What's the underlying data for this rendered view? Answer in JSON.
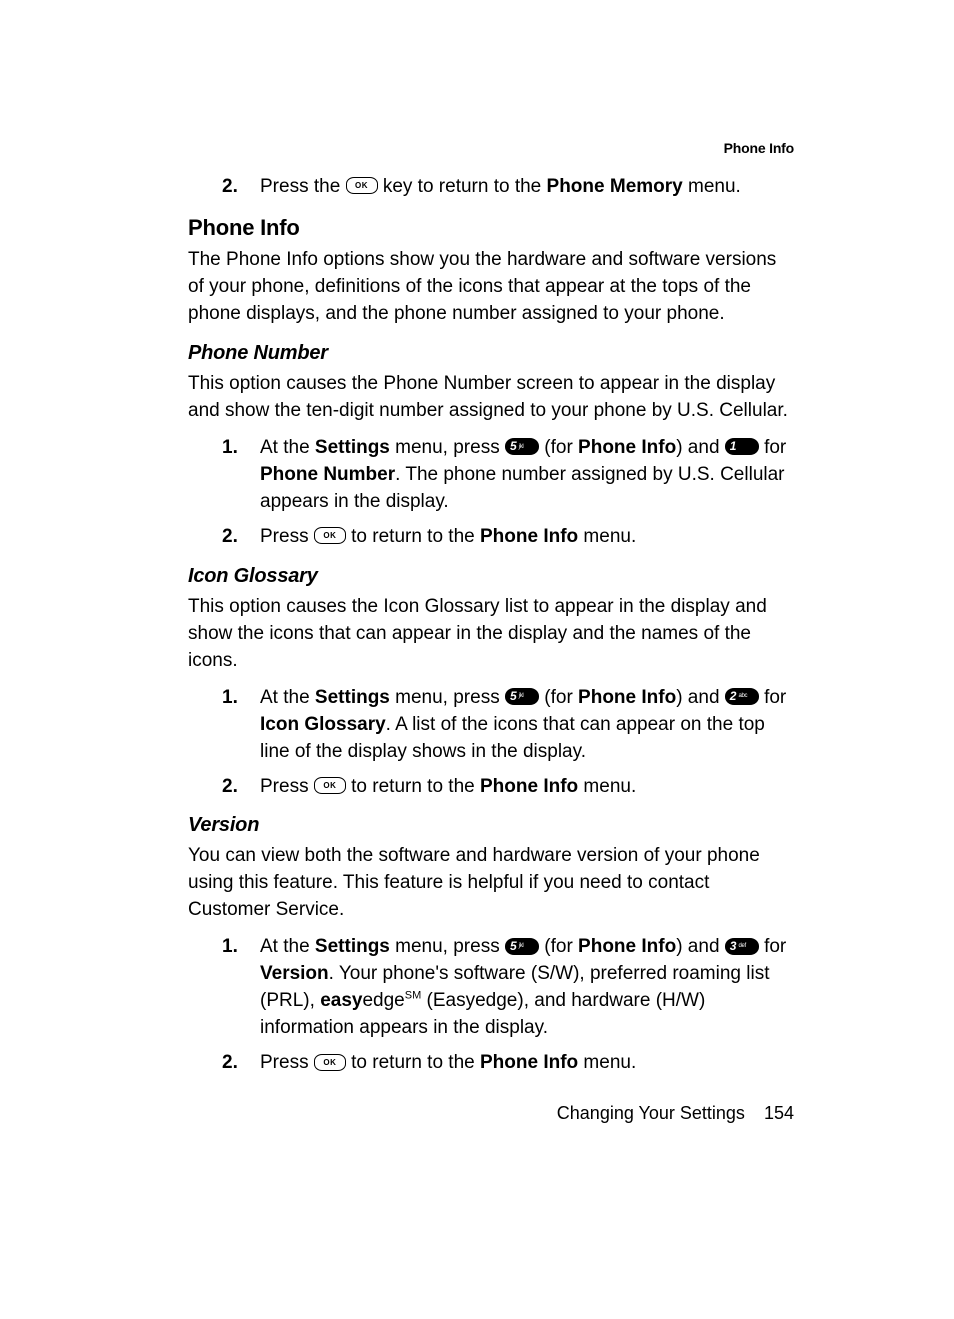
{
  "runningHead": "Phone Info",
  "topList": {
    "item2": {
      "num": "2.",
      "pre": "Press the ",
      "post1": " key to return to the ",
      "bold": "Phone Memory",
      "post2": " menu."
    }
  },
  "section": {
    "title": "Phone Info",
    "intro": "The Phone Info options show you the hardware and software versions of your phone, definitions of the icons that appear at the tops of the phone displays, and the phone number assigned to your phone."
  },
  "phoneNumber": {
    "title": "Phone Number",
    "intro": "This option causes the Phone Number screen to appear in the display and show the ten-digit number assigned to your phone by U.S. Cellular.",
    "step1": {
      "num": "1.",
      "a": "At the ",
      "settings": "Settings",
      "b": " menu, press ",
      "c": " (for ",
      "phoneInfo": "Phone Info",
      "d": ") and ",
      "e": " for ",
      "phoneNumber": "Phone Number",
      "f": ". The phone number assigned by U.S. Cellular appears in the display."
    },
    "step2": {
      "num": "2.",
      "a": "Press ",
      "b": " to return to the ",
      "phoneInfo": "Phone Info",
      "c": " menu."
    }
  },
  "iconGlossary": {
    "title": "Icon Glossary",
    "intro": "This option causes the Icon Glossary list to appear in the display and show the icons that can appear in the display and the names of the icons.",
    "step1": {
      "num": "1.",
      "a": "At the ",
      "settings": "Settings",
      "b": " menu, press ",
      "c": " (for ",
      "phoneInfo": "Phone Info",
      "d": ") and ",
      "e": " for ",
      "iconGlossary": "Icon Glossary",
      "f": ". A list of the icons that can appear on the top line of the display shows in the display."
    },
    "step2": {
      "num": "2.",
      "a": "Press ",
      "b": " to return to the ",
      "phoneInfo": "Phone Info",
      "c": " menu."
    }
  },
  "version": {
    "title": "Version",
    "intro": "You can view both the software and hardware version of your phone using this feature. This feature is helpful if you need to contact Customer Service.",
    "step1": {
      "num": "1.",
      "a": "At the ",
      "settings": "Settings",
      "b": " menu, press ",
      "c": " (for ",
      "phoneInfo": "Phone Info",
      "d": ") and ",
      "e": " for ",
      "versionWord": "Version",
      "f": ". Your phone's software (S/W), preferred roaming list (PRL), ",
      "easy": "easy",
      "edge": "edge",
      "sm": "SM",
      "g": " (Easyedge), and hardware (H/W) information appears in the display."
    },
    "step2": {
      "num": "2.",
      "a": "Press ",
      "b": " to return to the ",
      "phoneInfo": "Phone Info",
      "c": " menu."
    }
  },
  "keys": {
    "ok": "OK",
    "k5": "5",
    "k5sub": "jkl",
    "k1": "1",
    "k1sub": "",
    "k2": "2",
    "k2sub": "abc",
    "k3": "3",
    "k3sub": "def"
  },
  "footer": {
    "label": "Changing Your Settings",
    "page": "154"
  }
}
